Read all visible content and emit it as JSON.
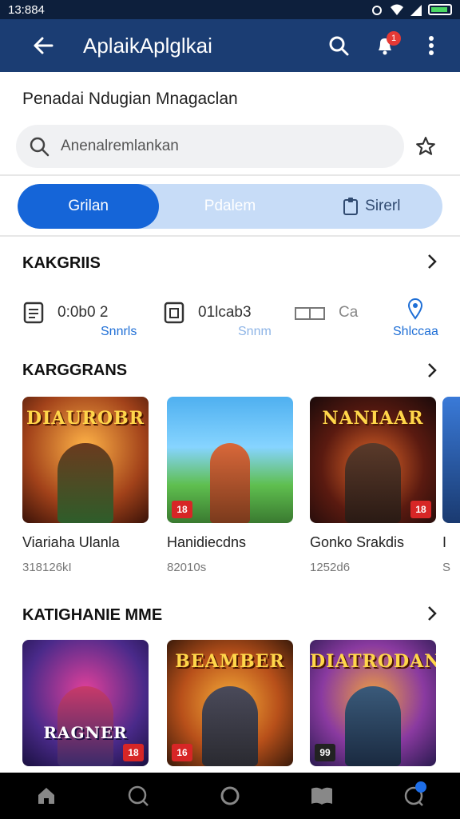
{
  "status_bar": {
    "time": "13:884"
  },
  "app_bar": {
    "title": "AplaikAplglkai",
    "notification_badge": "1"
  },
  "subtitle": "Penadai Ndugian Mnagaclan",
  "search": {
    "placeholder": "Anenalremlankan"
  },
  "tabs": [
    {
      "label": "Grilan"
    },
    {
      "label": "Pdalem"
    },
    {
      "label": "Sirerl"
    }
  ],
  "sections": {
    "stats_title": "KAKGRIIS",
    "featured_title": "KARGGRANS",
    "more_title": "KATIGHANIE MME"
  },
  "stats": [
    {
      "value": "0:0b0 2",
      "label": "Snnrls"
    },
    {
      "value": "01lcab3",
      "label": "Snnm"
    },
    {
      "value": "Ca",
      "label": "Shlccaa"
    }
  ],
  "featured_games": [
    {
      "name": "Viariaha Ulanla",
      "size": "318126kI",
      "art_title": "DIAUROBR",
      "rating": ""
    },
    {
      "name": "Hanidiecdns",
      "size": "82010s",
      "art_title": "",
      "rating": "18"
    },
    {
      "name": "Gonko Srakdis",
      "size": "1252d6",
      "art_title": "NANIAAR",
      "rating": "18"
    },
    {
      "name": "I",
      "size": "S",
      "art_title": "",
      "rating": ""
    }
  ],
  "more_games": [
    {
      "art_title": "RAGNER",
      "rating": "18"
    },
    {
      "art_title": "BEAMBER",
      "rating": "16"
    },
    {
      "art_title": "DIATRODAN",
      "rating": "99"
    }
  ],
  "colors": {
    "app_bar": "#1b3d73",
    "accent": "#1565d8",
    "tab_track": "#c7dcf7",
    "link": "#1f6fd6"
  }
}
